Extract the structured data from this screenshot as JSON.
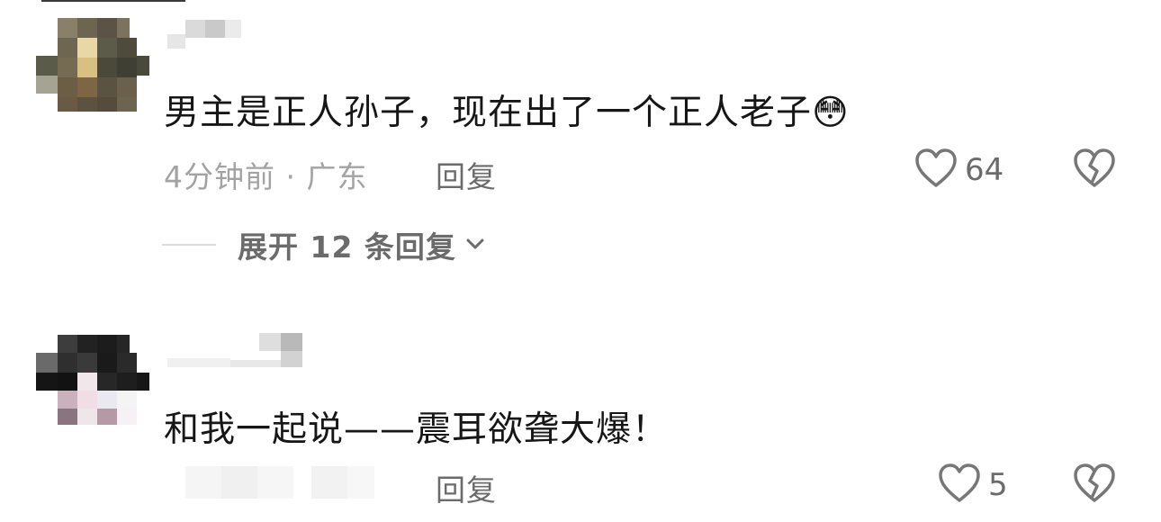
{
  "comments": [
    {
      "text": "男主是正人孙子，现在出了一个正人老子",
      "emoji": "😳",
      "meta": "4分钟前 · 广东",
      "reply_label": "回复",
      "like_count": "64",
      "expand_label": "展开 12 条回复"
    },
    {
      "text": "和我一起说——震耳欲聋大爆！",
      "reply_label": "回复",
      "like_count": "5"
    }
  ],
  "icons": {
    "like": "heart-outline-icon",
    "dislike": "broken-heart-icon",
    "expand": "chevron-down-icon"
  },
  "colors": {
    "text_primary": "#161616",
    "text_secondary": "#6b6b6b",
    "text_muted": "#a3a3a3"
  }
}
